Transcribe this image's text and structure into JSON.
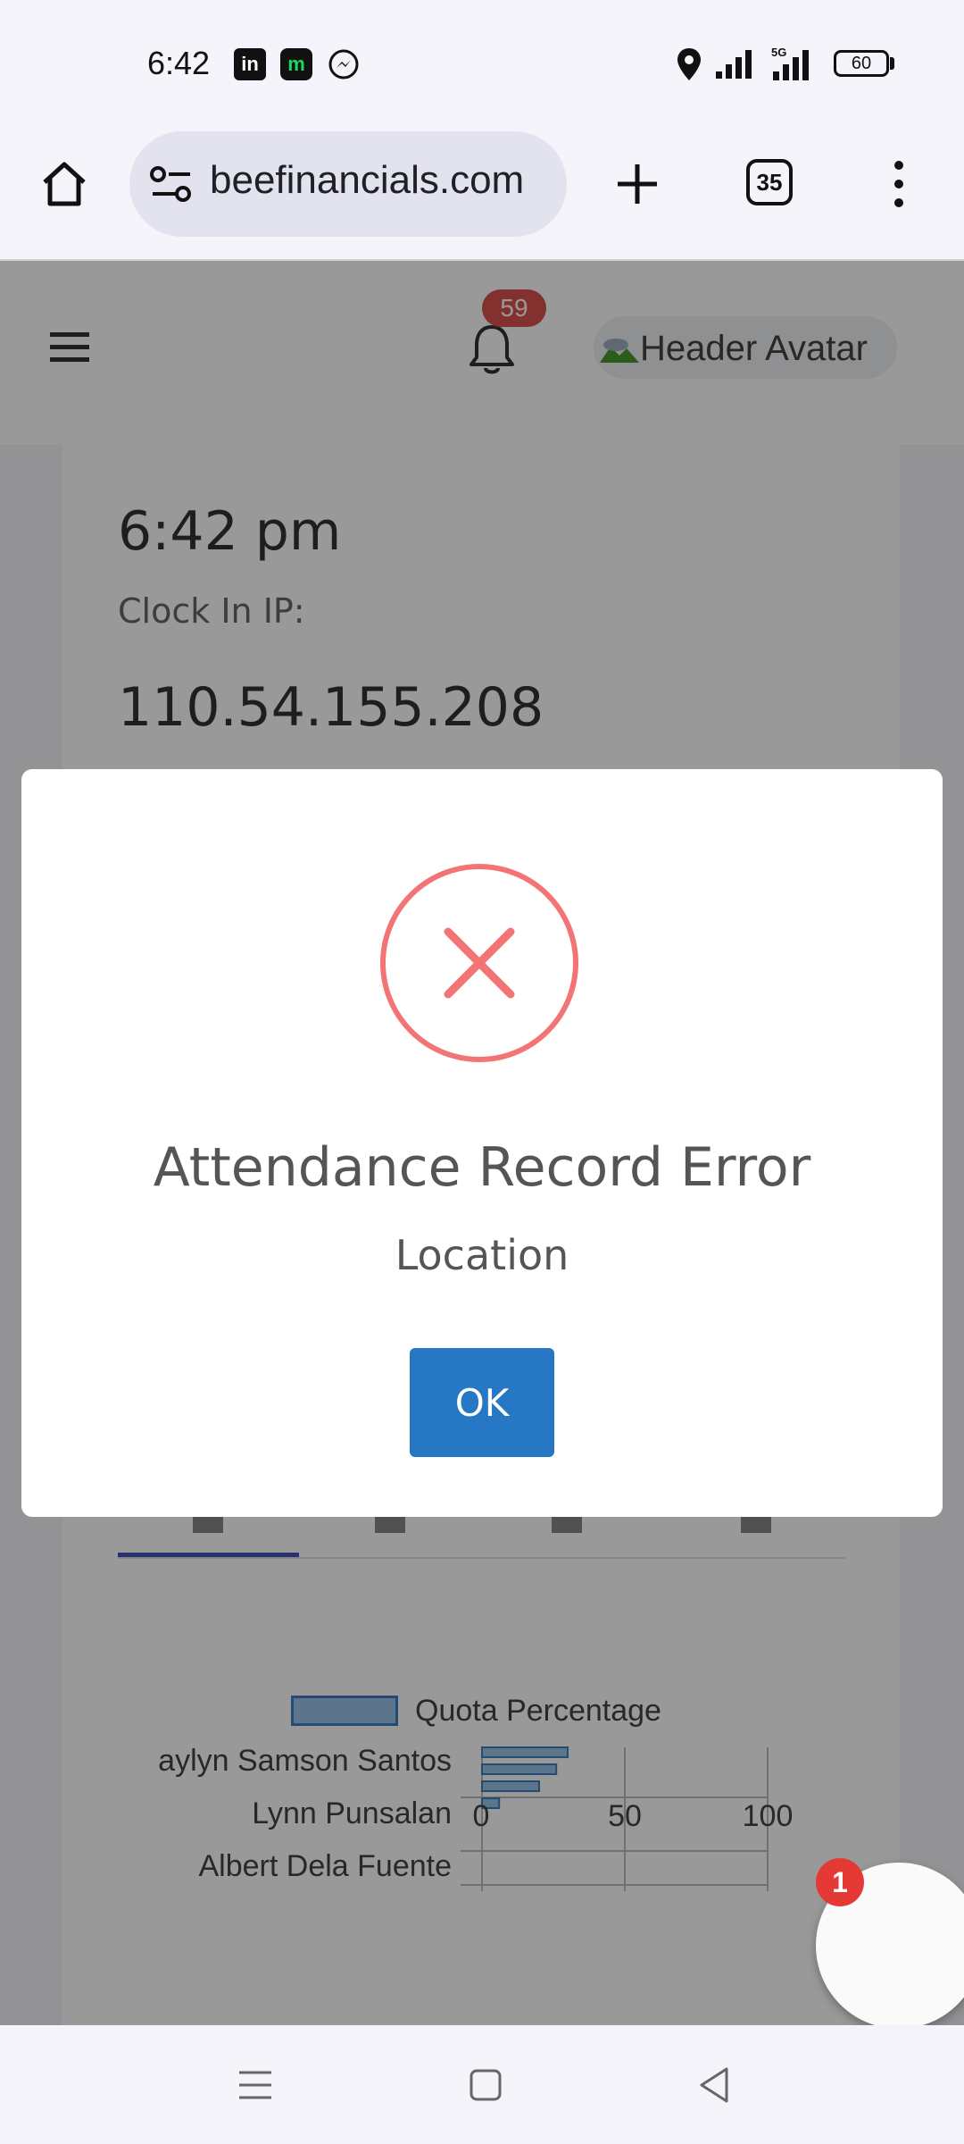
{
  "status_bar": {
    "time": "6:42",
    "apps": [
      "linkedin-icon",
      "m-app-icon",
      "messenger-icon"
    ],
    "network": "5G",
    "battery": "60"
  },
  "browser": {
    "url": "beefinancials.com",
    "tab_count": "35"
  },
  "header": {
    "notification_count": "59",
    "avatar_alt": "Header Avatar"
  },
  "clock": {
    "time": "6:42 pm",
    "ip_label": "Clock In IP:",
    "ip": "110.54.155.208"
  },
  "chart_data": {
    "type": "bar",
    "orientation": "horizontal",
    "legend": [
      "Quota Percentage"
    ],
    "y_tick_labels": [
      "aylyn Samson Santos",
      "Lynn Punsalan",
      "Albert Dela Fuente"
    ],
    "series": [
      {
        "name": "Quota Percentage",
        "values": [
          30,
          26,
          20,
          6
        ]
      }
    ],
    "xlim": [
      0,
      100
    ],
    "x_ticks": [
      "0",
      "50",
      "100"
    ],
    "colors": {
      "fill": "#9bc3e6",
      "border": "#3c7fc0"
    }
  },
  "fab": {
    "badge": "1"
  },
  "modal": {
    "title": "Attendance Record Error",
    "text": "Location",
    "ok_label": "OK",
    "icon": "error-x-icon",
    "icon_color": "#f27474",
    "button_color": "#2778c4"
  }
}
